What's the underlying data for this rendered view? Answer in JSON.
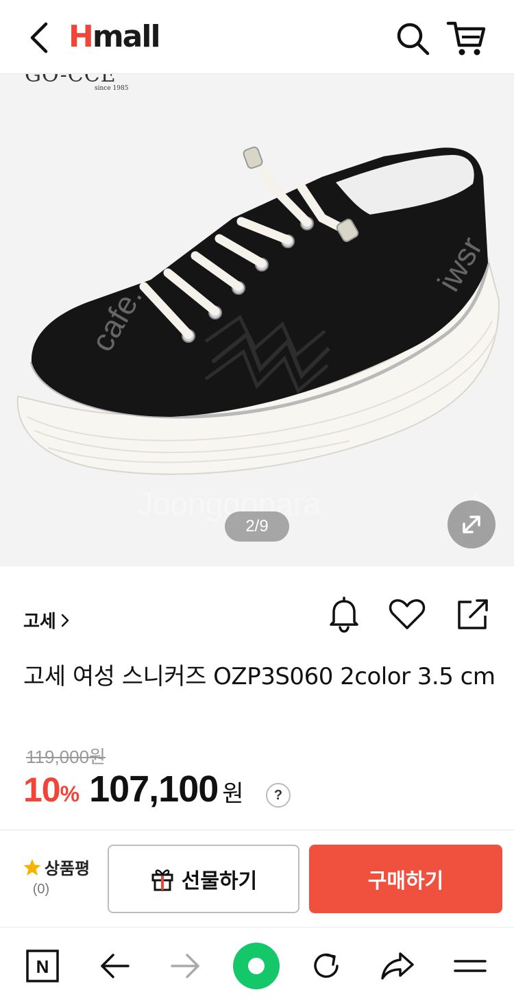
{
  "header": {
    "logo_h": "H",
    "logo_rest": "mall"
  },
  "gallery": {
    "brand_mark": "GO-CCE",
    "brand_since": "since 1985",
    "page_indicator": "2/9",
    "watermarks": [
      "cafe.",
      "iwsr",
      "Joonggonara",
      "iwsr"
    ]
  },
  "product": {
    "brand_link": "고세",
    "title": "고세 여성 스니커즈 OZP3S060 2color 3.5 cm",
    "original_price": "119,000원",
    "discount": "10",
    "discount_unit": "%",
    "sale_price": "107,100",
    "sale_unit": "원",
    "help": "?"
  },
  "action_bar": {
    "review_label": "상품평",
    "review_count": "(0)",
    "gift_label": "선물하기",
    "buy_label": "구매하기"
  },
  "colors": {
    "brand": "#f0463a",
    "buy": "#f0513f",
    "naver_green": "#14c86a"
  },
  "browser_toolbar": {
    "naver_label": "N"
  }
}
